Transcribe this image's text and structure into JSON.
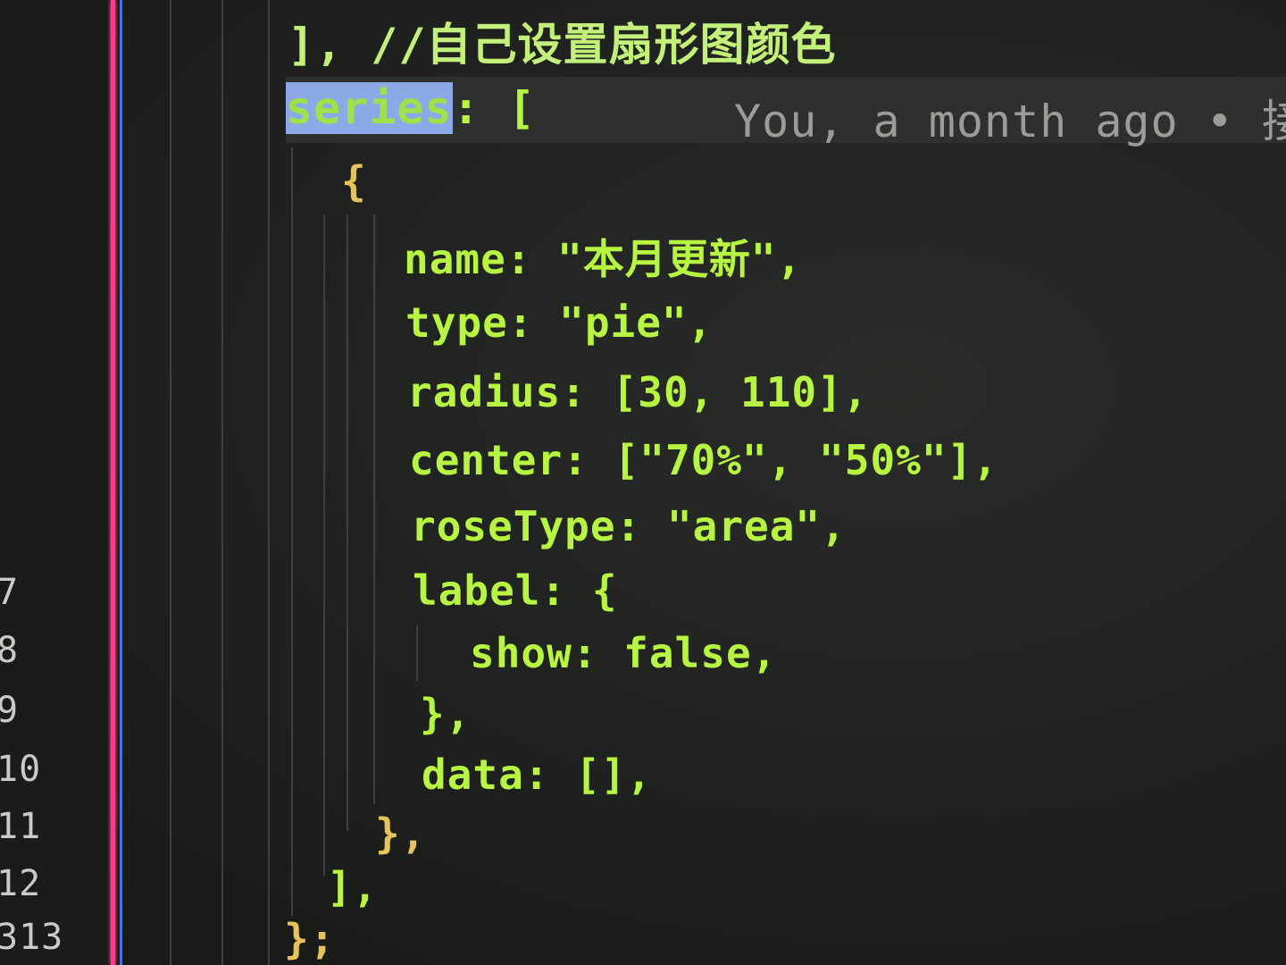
{
  "gutter": {
    "line_numbers": [
      "",
      "7",
      "8",
      "9",
      "10",
      "11",
      "12",
      "313"
    ]
  },
  "code": {
    "comment_line": "], //自己设置扇形图颜色",
    "series_key": "series",
    "series_rest": ": [",
    "blame": "You, a month ago • 接",
    "open_brace": "{",
    "name_line": "name: \"本月更新\",",
    "type_line": "type: \"pie\",",
    "radius_line": "radius: [30, 110],",
    "center_line": "center: [\"70%\", \"50%\"],",
    "rosetype_line": "roseType: \"area\",",
    "label_line": "label: {",
    "show_line": "show: false,",
    "label_close": "},",
    "data_line": "data: [],",
    "obj_close": "},",
    "series_close": "],",
    "final_close": "};"
  }
}
